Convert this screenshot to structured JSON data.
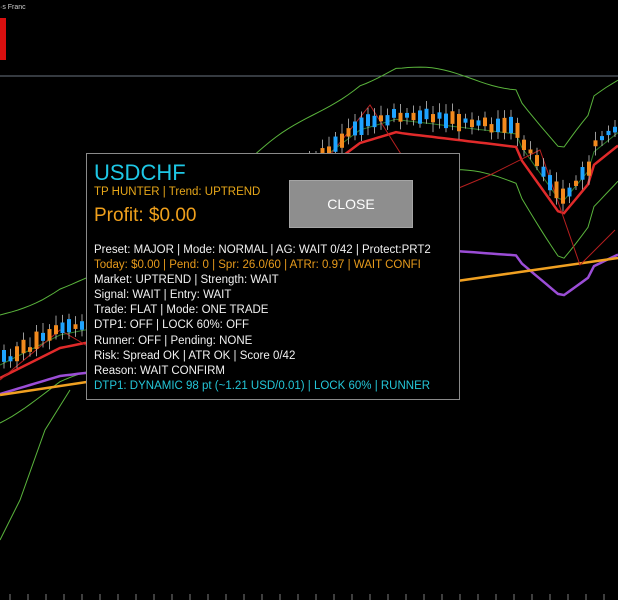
{
  "window": {
    "corner_label": "·s Franc"
  },
  "chart": {
    "candle_up_color": "#1ea3ff",
    "candle_down_color": "#f28a1e",
    "ma_fast_color": "#e02a2a",
    "ma_mid_color": "#9b4dd6",
    "ma_slow_color": "#f0a021",
    "band_color": "#5ab43c",
    "zigzag_color": "#b51f1f"
  },
  "panel": {
    "symbol": "USDCHF",
    "subtitle": "TP HUNTER | Trend: UPTREND",
    "profit": "Profit: $0.00",
    "close_label": "CLOSE",
    "lines": [
      {
        "text": "Preset: MAJOR | Mode: NORMAL | AG: WAIT 0/42 | Protect:PRT2",
        "style": "white"
      },
      {
        "text": "Today: $0.00 | Pend: 0 | Spr: 26.0/60 | ATRr: 0.97 | WAIT CONFI",
        "style": "orange"
      },
      {
        "text": "Market: UPTREND | Strength: WAIT",
        "style": "white"
      },
      {
        "text": "Signal: WAIT | Entry: WAIT",
        "style": "white"
      },
      {
        "text": "Trade: FLAT | Mode: ONE TRADE",
        "style": "white"
      },
      {
        "text": "DTP1: OFF | LOCK 60%: OFF",
        "style": "white"
      },
      {
        "text": "Runner: OFF | Pending: NONE",
        "style": "white"
      },
      {
        "text": "Risk: Spread OK | ATR OK | Score 0/42",
        "style": "white"
      },
      {
        "text": "Reason: WAIT CONFIRM",
        "style": "white"
      },
      {
        "text": "DTP1: DYNAMIC 98 pt (~1.21 USD/0.01) | LOCK 60% | RUNNER",
        "style": "cyan"
      }
    ]
  }
}
